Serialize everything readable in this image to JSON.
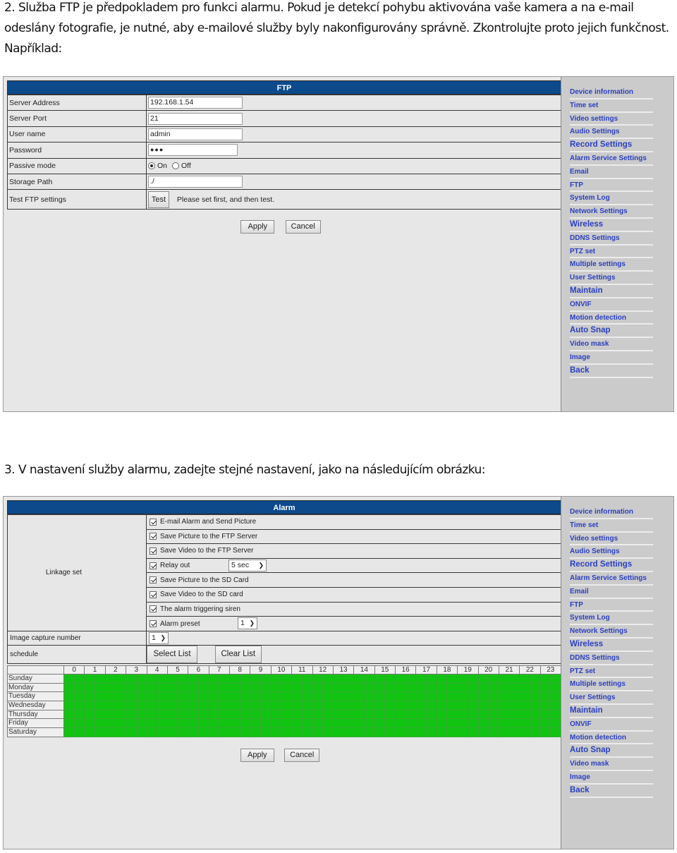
{
  "paragraphs": {
    "p1": "2. Služba FTP je předpokladem pro funkci alarmu. Pokud je detekcí pohybu aktivována vaše kamera a na e-mail odeslány fotografie, je nutné, aby e-mailové služby byly nakonfigurovány správně. Zkontrolujte proto jejich funkčnost. Například:",
    "p2": "3. V nastavení služby alarmu, zadejte stejné nastavení, jako na následujícím obrázku:"
  },
  "colors": {
    "header_bg": "#0c4a8c",
    "nav_link": "#2a3fc0",
    "schedule_on": "#12c412"
  },
  "sidebar": {
    "items": [
      {
        "label": "Device information"
      },
      {
        "label": "Time set"
      },
      {
        "label": "Video settings"
      },
      {
        "label": "Audio Settings"
      },
      {
        "label": "Record Settings"
      },
      {
        "label": "Alarm Service Settings"
      },
      {
        "label": "Email"
      },
      {
        "label": "FTP"
      },
      {
        "label": "System Log"
      },
      {
        "label": "Network Settings"
      },
      {
        "label": "Wireless"
      },
      {
        "label": "DDNS Settings"
      },
      {
        "label": "PTZ set"
      },
      {
        "label": "Multiple settings"
      },
      {
        "label": "User Settings"
      },
      {
        "label": "Maintain"
      },
      {
        "label": "ONVIF"
      },
      {
        "label": "Motion detection"
      },
      {
        "label": "Auto Snap"
      },
      {
        "label": "Video mask"
      },
      {
        "label": "Image"
      },
      {
        "label": "Back"
      }
    ]
  },
  "ftp": {
    "title": "FTP",
    "server_address": {
      "label": "Server Address",
      "value": "192.168.1.54"
    },
    "server_port": {
      "label": "Server Port",
      "value": "21"
    },
    "user_name": {
      "label": "User name",
      "value": "admin"
    },
    "password": {
      "label": "Password",
      "value": "●●●"
    },
    "passive_mode": {
      "label": "Passive mode",
      "options": [
        "On",
        "Off"
      ],
      "selected": "On"
    },
    "storage_path": {
      "label": "Storage Path",
      "value": "./"
    },
    "test": {
      "label": "Test FTP settings",
      "button": "Test",
      "hint": "Please set first, and then test."
    },
    "apply": "Apply",
    "cancel": "Cancel"
  },
  "alarm": {
    "title": "Alarm",
    "linkage_label": "Linkage set",
    "linkage": [
      {
        "label": "E-mail Alarm and Send Picture",
        "checked": true
      },
      {
        "label": "Save Picture to the FTP Server",
        "checked": true
      },
      {
        "label": "Save Video to the FTP Server",
        "checked": true
      },
      {
        "label": "Relay out",
        "checked": true,
        "select": "5 sec"
      },
      {
        "label": "Save Picture to the SD Card",
        "checked": true
      },
      {
        "label": "Save Video to the SD card",
        "checked": true
      },
      {
        "label": "The alarm triggering siren",
        "checked": true
      },
      {
        "label": "Alarm preset",
        "checked": true,
        "select": "1"
      }
    ],
    "image_capture": {
      "label": "Image capture number",
      "value": "1"
    },
    "schedule": {
      "label": "schedule",
      "select_list": "Select List",
      "clear_list": "Clear List"
    },
    "apply": "Apply",
    "cancel": "Cancel"
  },
  "schedule_grid": {
    "hours": [
      "0",
      "1",
      "2",
      "3",
      "4",
      "5",
      "6",
      "7",
      "8",
      "9",
      "10",
      "11",
      "12",
      "13",
      "14",
      "15",
      "16",
      "17",
      "18",
      "19",
      "20",
      "21",
      "22",
      "23"
    ],
    "days": [
      "Sunday",
      "Monday",
      "Tuesday",
      "Wednesday",
      "Thursday",
      "Friday",
      "Saturday"
    ],
    "slots_per_hour": 2,
    "all_enabled": true
  }
}
